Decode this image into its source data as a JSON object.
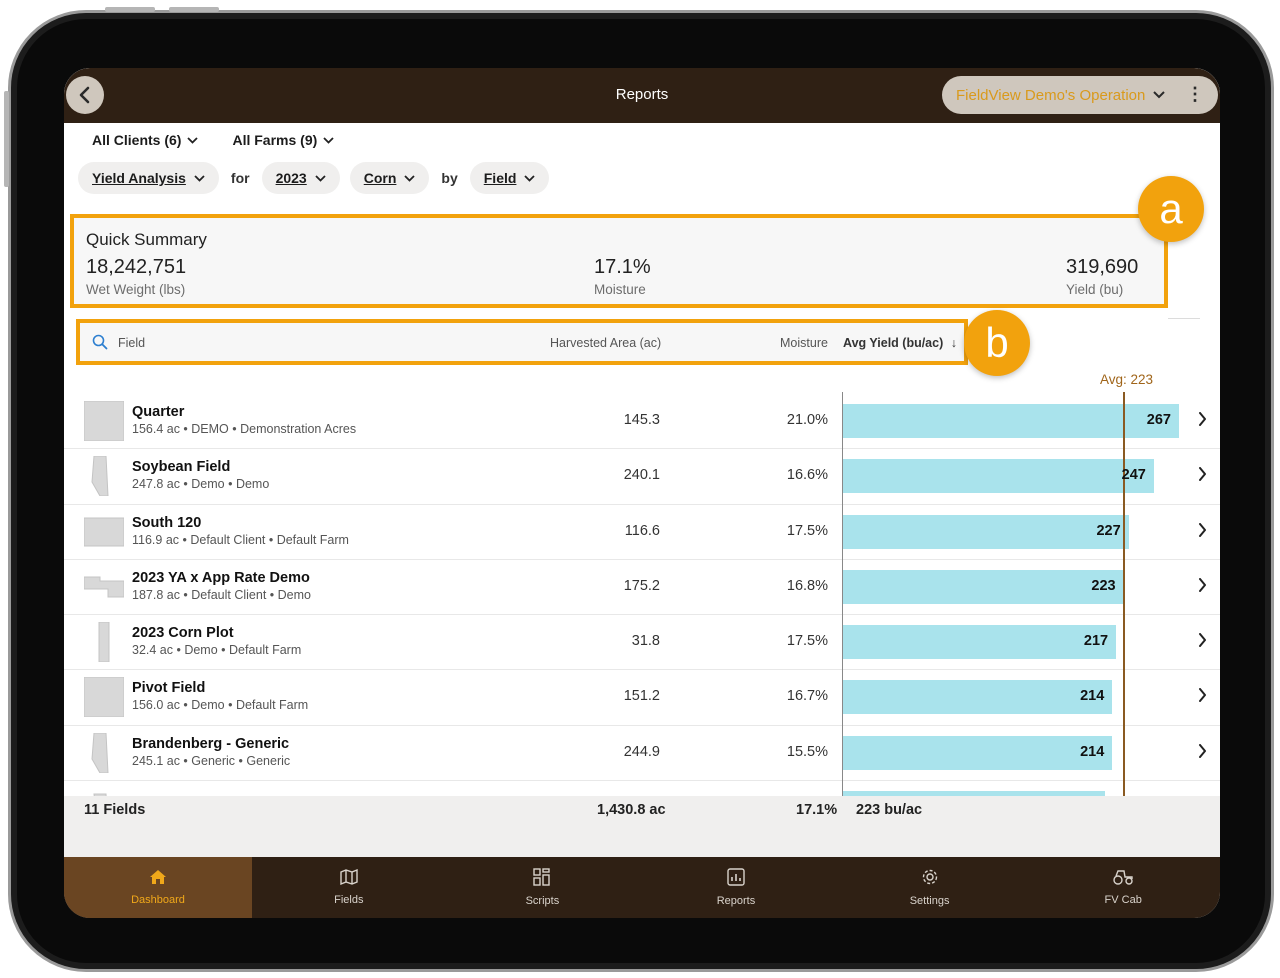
{
  "header": {
    "title": "Reports",
    "operation": "FieldView Demo's Operation"
  },
  "filters": {
    "clients": "All Clients (6)",
    "farms": "All Farms (9)",
    "report_type": "Yield Analysis",
    "for_word": "for",
    "year": "2023",
    "crop": "Corn",
    "by_word": "by",
    "group_by": "Field"
  },
  "summary": {
    "title": "Quick Summary",
    "wet_weight": {
      "value": "18,242,751",
      "label": "Wet Weight (lbs)"
    },
    "moisture": {
      "value": "17.1%",
      "label": "Moisture"
    },
    "yield": {
      "value": "319,690",
      "label": "Yield (bu)"
    }
  },
  "table": {
    "search_placeholder": "Field",
    "col_area": "Harvested Area (ac)",
    "col_moisture": "Moisture",
    "col_yield": "Avg Yield (bu/ac)",
    "avg_label": "Avg: 223",
    "avg_value": 223,
    "rows": [
      {
        "name": "Quarter",
        "meta": "156.4 ac • DEMO • Demonstration Acres",
        "area": "145.3",
        "moisture": "21.0%",
        "yield": "267",
        "yield_num": 267,
        "shape": "square"
      },
      {
        "name": "Soybean Field",
        "meta": "247.8 ac • Demo • Demo",
        "area": "240.1",
        "moisture": "16.6%",
        "yield": "247",
        "yield_num": 247,
        "shape": "sliver"
      },
      {
        "name": "South 120",
        "meta": "116.9 ac • Default Client • Default Farm",
        "area": "116.6",
        "moisture": "17.5%",
        "yield": "227",
        "yield_num": 227,
        "shape": "wide"
      },
      {
        "name": "2023 YA x App Rate Demo",
        "meta": "187.8 ac • Default Client • Demo",
        "area": "175.2",
        "moisture": "16.8%",
        "yield": "223",
        "yield_num": 223,
        "shape": "step"
      },
      {
        "name": "2023 Corn Plot",
        "meta": "32.4 ac • Demo • Default Farm",
        "area": "31.8",
        "moisture": "17.5%",
        "yield": "217",
        "yield_num": 217,
        "shape": "thin"
      },
      {
        "name": "Pivot Field",
        "meta": "156.0 ac • Demo • Default Farm",
        "area": "151.2",
        "moisture": "16.7%",
        "yield": "214",
        "yield_num": 214,
        "shape": "square"
      },
      {
        "name": "Brandenberg - Generic",
        "meta": "245.1 ac • Generic • Generic",
        "area": "244.9",
        "moisture": "15.5%",
        "yield": "214",
        "yield_num": 214,
        "shape": "sliver"
      },
      {
        "name": "",
        "meta": "",
        "area": "",
        "moisture": "",
        "yield": "",
        "yield_num": 208,
        "shape": "partial"
      }
    ]
  },
  "totals": {
    "fields": "11 Fields",
    "area": "1,430.8 ac",
    "moisture": "17.1%",
    "yield": "223 bu/ac"
  },
  "nav": [
    {
      "label": "Dashboard",
      "icon": "home-icon"
    },
    {
      "label": "Fields",
      "icon": "map-icon"
    },
    {
      "label": "Scripts",
      "icon": "scripts-icon"
    },
    {
      "label": "Reports",
      "icon": "reports-icon"
    },
    {
      "label": "Settings",
      "icon": "gear-icon"
    },
    {
      "label": "FV Cab",
      "icon": "tractor-icon"
    }
  ],
  "annotations": {
    "a": "a",
    "b": "b"
  },
  "colors": {
    "accent": "#f2a20d",
    "header_bg": "#2f2014",
    "bar": "#a9e3ec",
    "active_nav": "#6a4522",
    "operation_text": "#d99a1c"
  }
}
